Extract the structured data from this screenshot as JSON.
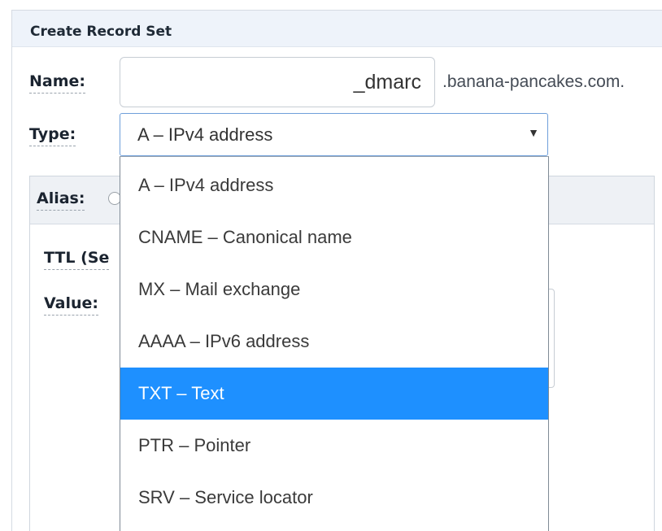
{
  "panel": {
    "title": "Create Record Set"
  },
  "name_field": {
    "label": "Name:",
    "value": "_dmarc",
    "suffix": ".banana-pancakes.com."
  },
  "type_field": {
    "label": "Type:",
    "selected_value": "A – IPv4 address",
    "arrow_glyph": "▼"
  },
  "alias_section": {
    "label": "Alias:",
    "ttl_label": "TTL (Se",
    "value_label": "Value:"
  },
  "dropdown": {
    "highlighted_color": "#1e90ff",
    "options": [
      "A – IPv4 address",
      "CNAME – Canonical name",
      "MX – Mail exchange",
      "AAAA – IPv6 address",
      "TXT – Text",
      "PTR – Pointer",
      "SRV – Service locator"
    ],
    "highlighted_index": 4
  }
}
